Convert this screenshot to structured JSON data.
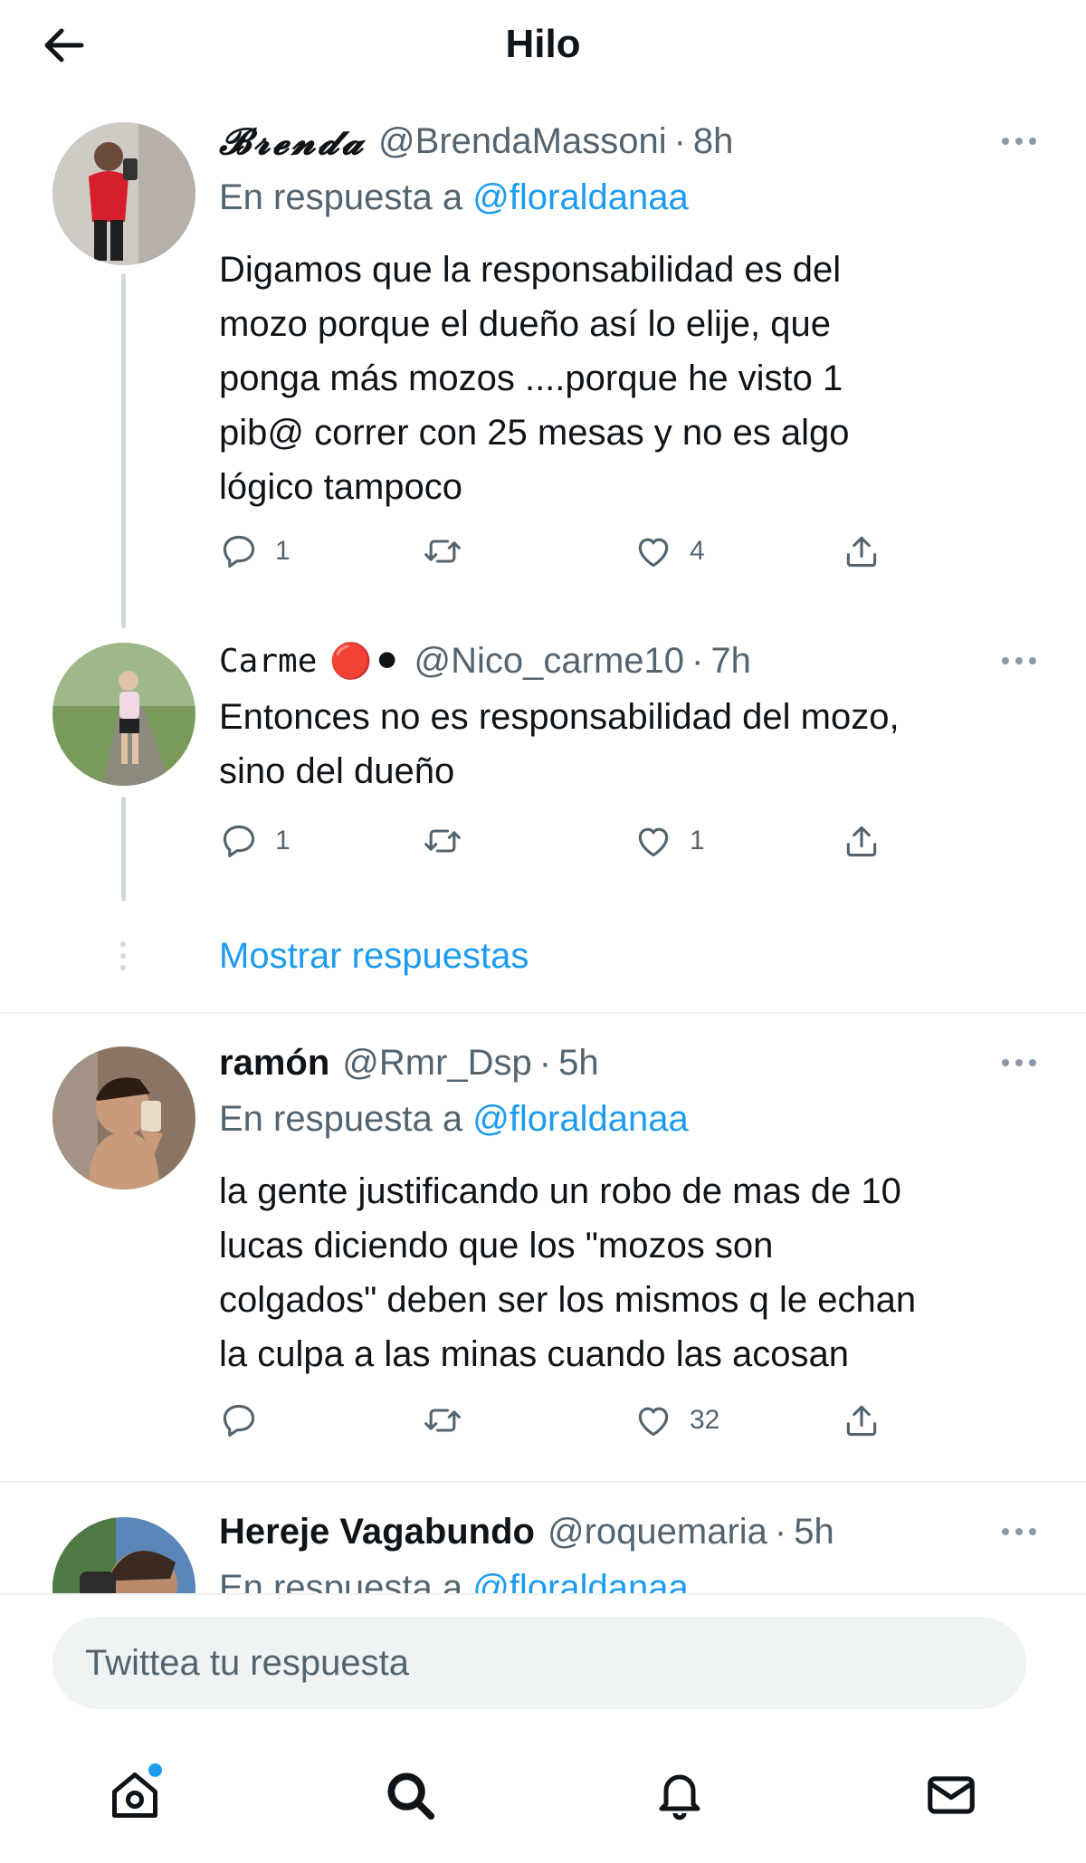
{
  "header": {
    "title": "Hilo",
    "back_icon": "arrow-left-icon"
  },
  "colors": {
    "accent": "#1d9bf0",
    "muted": "#536471",
    "text": "#0f1419",
    "divider": "#eff3f4"
  },
  "tweets": [
    {
      "name": "𝓑𝓻𝓮𝓷𝓭𝓪",
      "handle": "@BrendaMassoni",
      "dot": "·",
      "time": "8h",
      "reply_prefix": "En respuesta a",
      "reply_mention": "@floraldanaa",
      "text": "Digamos que la responsabilidad es del\nmozo porque el dueño así lo elije, que\nponga más mozos ....porque he visto 1\npib@ correr con 25 mesas y no es algo\nlógico tampoco",
      "replies": "1",
      "retweets": "",
      "likes": "4"
    },
    {
      "name": "Carme",
      "emoji": "🔴⚫",
      "handle": "@Nico_carme10",
      "dot": "·",
      "time": "7h",
      "text": "Entonces no es responsabilidad del mozo,\nsino del dueño",
      "replies": "1",
      "retweets": "",
      "likes": "1"
    },
    {
      "name": "ramón",
      "handle": "@Rmr_Dsp",
      "dot": "·",
      "time": "5h",
      "reply_prefix": "En respuesta a",
      "reply_mention": "@floraldanaa",
      "text": "la gente justificando un robo de mas de 10\nlucas diciendo que los \"mozos son\ncolgados\" deben ser los mismos q le echan\nla culpa a las minas cuando las acosan",
      "replies": "",
      "retweets": "",
      "likes": "32"
    },
    {
      "name": "Hereje Vagabundo",
      "handle": "@roquemaria",
      "dot": "·",
      "time": "5h",
      "reply_prefix": "En respuesta a",
      "reply_mention": "@floraldanaa"
    }
  ],
  "show_replies_label": "Mostrar respuestas",
  "reply_bar": {
    "placeholder": "Twittea tu respuesta"
  },
  "nav": [
    {
      "icon": "home-icon"
    },
    {
      "icon": "search-icon"
    },
    {
      "icon": "bell-icon"
    },
    {
      "icon": "mail-icon"
    }
  ]
}
